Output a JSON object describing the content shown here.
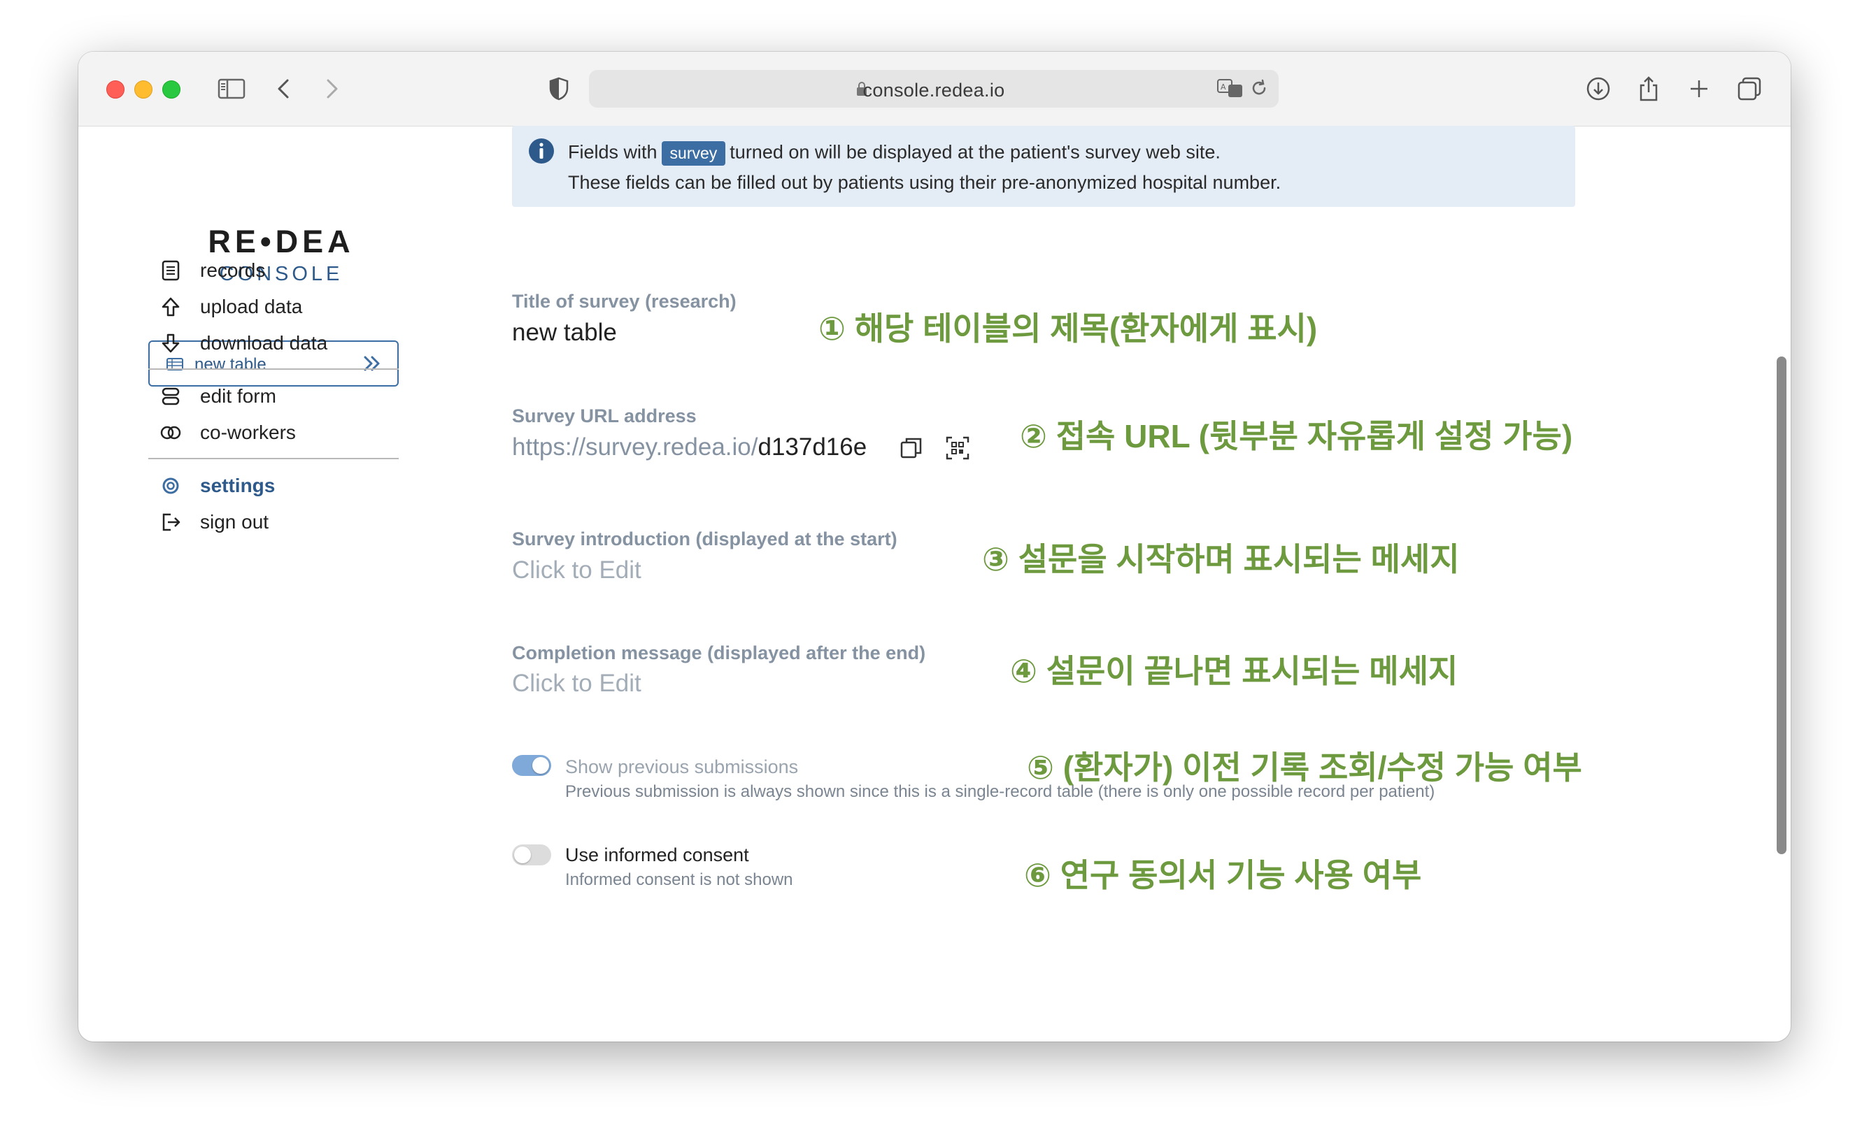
{
  "browser": {
    "url": "console.redea.io",
    "toolbar_icons": [
      "sidebar-toggle-icon",
      "back-icon",
      "forward-icon",
      "shield-icon",
      "download-icon",
      "share-icon",
      "new-tab-icon",
      "tabs-overview-icon"
    ]
  },
  "sidebar": {
    "logo_main": "RE•DEA",
    "logo_sub": "CONSOLE",
    "table_selector": "new table",
    "items": [
      {
        "label": "records",
        "icon": "document-icon"
      },
      {
        "label": "upload data",
        "icon": "upload-arrow-icon"
      },
      {
        "label": "download data",
        "icon": "download-arrow-icon"
      },
      {
        "label": "edit form",
        "icon": "form-icon"
      },
      {
        "label": "co-workers",
        "icon": "co-workers-icon"
      },
      {
        "label": "settings",
        "icon": "settings-icon",
        "active": true
      },
      {
        "label": "sign out",
        "icon": "sign-out-icon"
      }
    ]
  },
  "info": {
    "text_before": "Fields with",
    "badge": "survey",
    "text_after": "turned on will be displayed at the patient's survey web site.",
    "line2": "These fields can be filled out by patients using their pre-anonymized hospital number."
  },
  "fields": {
    "title": {
      "label": "Title of survey (research)",
      "value": "new table"
    },
    "url": {
      "label": "Survey URL address",
      "prefix": "https://survey.redea.io/",
      "suffix": "d137d16e"
    },
    "intro": {
      "label": "Survey introduction (displayed at the start)",
      "value": "Click to Edit"
    },
    "completion": {
      "label": "Completion message (displayed after the end)",
      "value": "Click to Edit"
    }
  },
  "toggles": {
    "previous": {
      "label": "Show previous submissions",
      "desc": "Previous submission is always shown since this is a single-record table (there is only one possible record per patient)",
      "on": true
    },
    "consent": {
      "label": "Use informed consent",
      "desc": "Informed consent is not shown",
      "on": false
    }
  },
  "annotations": [
    "① 해당 테이블의 제목(환자에게 표시)",
    "② 접속 URL (뒷부분 자유롭게 설정 가능)",
    "③ 설문을 시작하며 표시되는 메세지",
    "④ 설문이 끝나면 표시되는 메세지",
    "⑤ (환자가) 이전 기록 조회/수정 가능 여부",
    "⑥ 연구 동의서 기능 사용 여부"
  ],
  "colors": {
    "accent": "#3d6ea3",
    "annotation": "#6e9a3f",
    "info_bg": "#e4ecf5"
  }
}
